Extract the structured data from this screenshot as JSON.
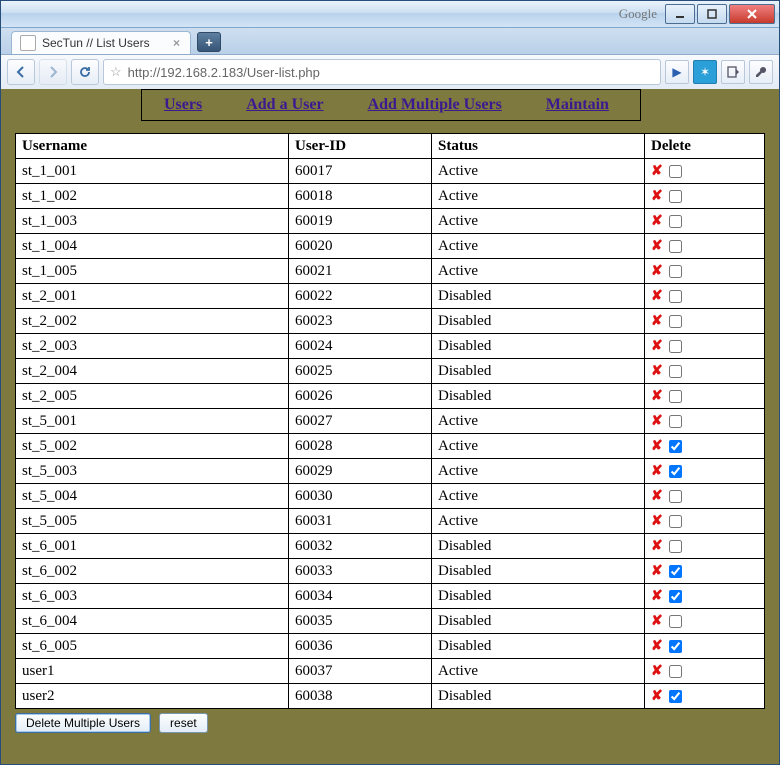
{
  "window": {
    "search_brand": "Google"
  },
  "tab": {
    "title": "SecTun // List Users"
  },
  "toolbar": {
    "url": "http://192.168.2.183/User-list.php"
  },
  "nav": {
    "users": "Users",
    "add_user": "Add a User",
    "add_multiple": "Add Multiple Users",
    "maintain": "Maintain"
  },
  "table": {
    "headers": {
      "username": "Username",
      "user_id": "User-ID",
      "status": "Status",
      "delete": "Delete"
    },
    "rows": [
      {
        "username": "st_1_001",
        "user_id": "60017",
        "status": "Active",
        "checked": false
      },
      {
        "username": "st_1_002",
        "user_id": "60018",
        "status": "Active",
        "checked": false
      },
      {
        "username": "st_1_003",
        "user_id": "60019",
        "status": "Active",
        "checked": false
      },
      {
        "username": "st_1_004",
        "user_id": "60020",
        "status": "Active",
        "checked": false
      },
      {
        "username": "st_1_005",
        "user_id": "60021",
        "status": "Active",
        "checked": false
      },
      {
        "username": "st_2_001",
        "user_id": "60022",
        "status": "Disabled",
        "checked": false
      },
      {
        "username": "st_2_002",
        "user_id": "60023",
        "status": "Disabled",
        "checked": false
      },
      {
        "username": "st_2_003",
        "user_id": "60024",
        "status": "Disabled",
        "checked": false
      },
      {
        "username": "st_2_004",
        "user_id": "60025",
        "status": "Disabled",
        "checked": false
      },
      {
        "username": "st_2_005",
        "user_id": "60026",
        "status": "Disabled",
        "checked": false
      },
      {
        "username": "st_5_001",
        "user_id": "60027",
        "status": "Active",
        "checked": false
      },
      {
        "username": "st_5_002",
        "user_id": "60028",
        "status": "Active",
        "checked": true
      },
      {
        "username": "st_5_003",
        "user_id": "60029",
        "status": "Active",
        "checked": true
      },
      {
        "username": "st_5_004",
        "user_id": "60030",
        "status": "Active",
        "checked": false
      },
      {
        "username": "st_5_005",
        "user_id": "60031",
        "status": "Active",
        "checked": false
      },
      {
        "username": "st_6_001",
        "user_id": "60032",
        "status": "Disabled",
        "checked": false
      },
      {
        "username": "st_6_002",
        "user_id": "60033",
        "status": "Disabled",
        "checked": true
      },
      {
        "username": "st_6_003",
        "user_id": "60034",
        "status": "Disabled",
        "checked": true
      },
      {
        "username": "st_6_004",
        "user_id": "60035",
        "status": "Disabled",
        "checked": false
      },
      {
        "username": "st_6_005",
        "user_id": "60036",
        "status": "Disabled",
        "checked": true
      },
      {
        "username": "user1",
        "user_id": "60037",
        "status": "Active",
        "checked": false
      },
      {
        "username": "user2",
        "user_id": "60038",
        "status": "Disabled",
        "checked": true
      }
    ]
  },
  "buttons": {
    "delete_multiple": "Delete Multiple Users",
    "reset": "reset"
  }
}
